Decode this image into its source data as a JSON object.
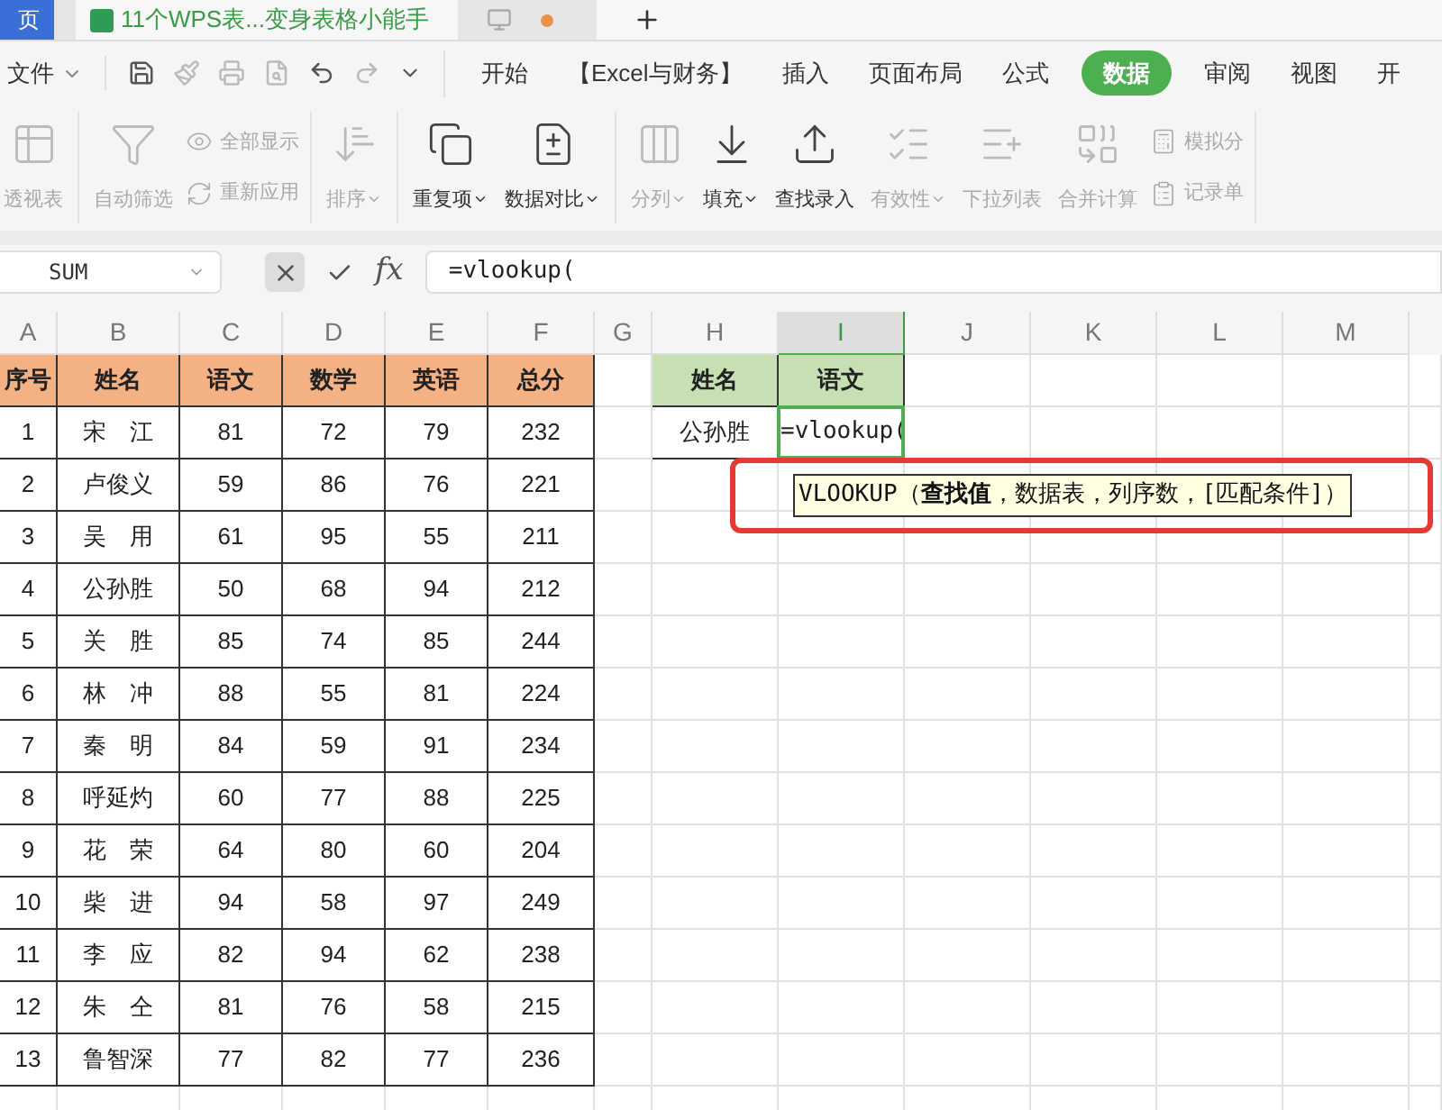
{
  "tabs": [
    {
      "label": "页",
      "selected": false,
      "kind": "plain"
    },
    {
      "label": "11个WPS表...变身表格小能手",
      "selected": true,
      "kind": "sheet"
    }
  ],
  "menu": {
    "file": "文件",
    "items": [
      {
        "label": "开始",
        "selected": false
      },
      {
        "label": "【Excel与财务】",
        "selected": false
      },
      {
        "label": "插入",
        "selected": false
      },
      {
        "label": "页面布局",
        "selected": false
      },
      {
        "label": "公式",
        "selected": false
      },
      {
        "label": "数据",
        "selected": true
      },
      {
        "label": "审阅",
        "selected": false
      },
      {
        "label": "视图",
        "selected": false
      },
      {
        "label": "开",
        "selected": false
      }
    ]
  },
  "ribbon": {
    "groups": [
      [
        {
          "kind": "large",
          "label": "透视表",
          "disabled": true,
          "dropdown": false
        }
      ],
      [
        {
          "kind": "large",
          "label": "自动筛选",
          "disabled": true,
          "dropdown": false
        },
        {
          "kind": "pair",
          "items": [
            {
              "label": "全部显示",
              "disabled": true
            },
            {
              "label": "重新应用",
              "disabled": true
            }
          ]
        }
      ],
      [
        {
          "kind": "large",
          "label": "排序",
          "disabled": true,
          "dropdown": true
        }
      ],
      [
        {
          "kind": "large",
          "label": "重复项",
          "disabled": false,
          "dropdown": true
        },
        {
          "kind": "large",
          "label": "数据对比",
          "disabled": false,
          "dropdown": true
        }
      ],
      [
        {
          "kind": "large",
          "label": "分列",
          "disabled": true,
          "dropdown": true
        },
        {
          "kind": "large",
          "label": "填充",
          "disabled": false,
          "dropdown": true
        },
        {
          "kind": "large",
          "label": "查找录入",
          "disabled": false,
          "dropdown": false
        },
        {
          "kind": "large",
          "label": "有效性",
          "disabled": true,
          "dropdown": true
        },
        {
          "kind": "large",
          "label": "下拉列表",
          "disabled": true,
          "dropdown": false
        },
        {
          "kind": "large",
          "label": "合并计算",
          "disabled": true,
          "dropdown": false
        },
        {
          "kind": "pair",
          "items": [
            {
              "label": "模拟分",
              "disabled": true
            },
            {
              "label": "记录单",
              "disabled": true
            }
          ]
        }
      ]
    ]
  },
  "formula_bar": {
    "name_box": "SUM",
    "function_label": "fx",
    "formula": "=vlookup("
  },
  "columns": [
    {
      "label": "A",
      "selected": false
    },
    {
      "label": "B",
      "selected": false
    },
    {
      "label": "C",
      "selected": false
    },
    {
      "label": "D",
      "selected": false
    },
    {
      "label": "E",
      "selected": false
    },
    {
      "label": "F",
      "selected": false
    },
    {
      "label": "G",
      "selected": false
    },
    {
      "label": "H",
      "selected": false
    },
    {
      "label": "I",
      "selected": true
    },
    {
      "label": "J",
      "selected": false
    },
    {
      "label": "K",
      "selected": false
    },
    {
      "label": "L",
      "selected": false
    },
    {
      "label": "M",
      "selected": false
    }
  ],
  "table": {
    "headers": [
      "序号",
      "姓名",
      "语文",
      "数学",
      "英语",
      "总分"
    ],
    "rows": [
      [
        "1",
        "宋　江",
        "81",
        "72",
        "79",
        "232"
      ],
      [
        "2",
        "卢俊义",
        "59",
        "86",
        "76",
        "221"
      ],
      [
        "3",
        "吴　用",
        "61",
        "95",
        "55",
        "211"
      ],
      [
        "4",
        "公孙胜",
        "50",
        "68",
        "94",
        "212"
      ],
      [
        "5",
        "关　胜",
        "85",
        "74",
        "85",
        "244"
      ],
      [
        "6",
        "林　冲",
        "88",
        "55",
        "81",
        "224"
      ],
      [
        "7",
        "秦　明",
        "84",
        "59",
        "91",
        "234"
      ],
      [
        "8",
        "呼延灼",
        "60",
        "77",
        "88",
        "225"
      ],
      [
        "9",
        "花　荣",
        "64",
        "80",
        "60",
        "204"
      ],
      [
        "10",
        "柴　进",
        "94",
        "58",
        "97",
        "249"
      ],
      [
        "11",
        "李　应",
        "82",
        "94",
        "62",
        "238"
      ],
      [
        "12",
        "朱　仝",
        "81",
        "76",
        "58",
        "215"
      ],
      [
        "13",
        "鲁智深",
        "77",
        "82",
        "77",
        "236"
      ]
    ]
  },
  "lookup": {
    "headers": [
      "姓名",
      "语文"
    ],
    "row": [
      "公孙胜",
      "=vlookup("
    ]
  },
  "tooltip": "VLOOKUP（**查找值**，数据表，列序数，[匹配条件]）"
}
